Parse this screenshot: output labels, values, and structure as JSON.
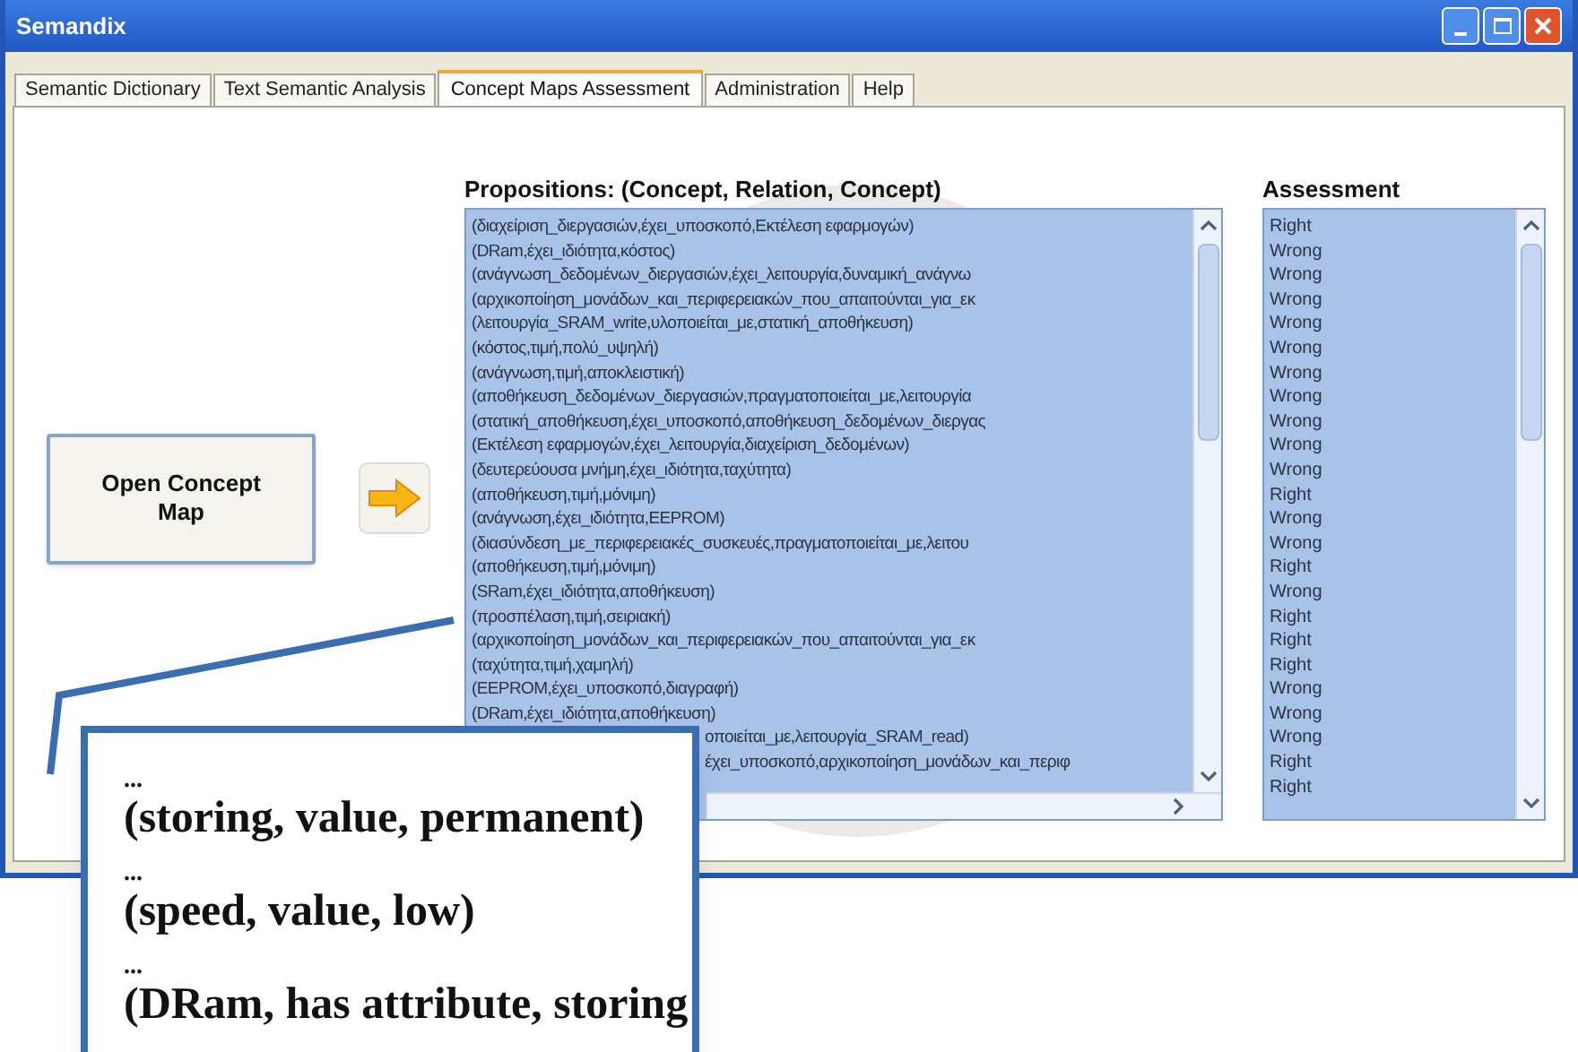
{
  "window": {
    "title": "Semandix"
  },
  "tabs": [
    {
      "label": "Semantic Dictionary",
      "selected": false
    },
    {
      "label": "Text Semantic Analysis",
      "selected": false
    },
    {
      "label": "Concept Maps Assessment",
      "selected": true
    },
    {
      "label": "Administration",
      "selected": false
    },
    {
      "label": "Help",
      "selected": false
    }
  ],
  "open_button": {
    "label": "Open Concept Map"
  },
  "propositions": {
    "header": "Propositions: (Concept, Relation, Concept)",
    "rows": [
      {
        "text": "(διαχείριση_διεργασιών,έχει_υποσκοπό,Εκτέλεση εφαρμογών)",
        "kind": "full"
      },
      {
        "text": "(DRam,έχει_ιδιότητα,κόστος)",
        "kind": "full"
      },
      {
        "text": "(ανάγνωση_δεδομένων_διεργασιών,έχει_λειτουργία,δυναμική_ανάγνω",
        "kind": "full"
      },
      {
        "text": "(αρχικοποίηση_μονάδων_και_περιφερειακών_που_απαιτούνται_για_εκ",
        "kind": "full"
      },
      {
        "text": "(λειτουργία_SRAM_write,υλοποιείται_με,στατική_αποθήκευση)",
        "kind": "full"
      },
      {
        "text": "(κόστος,τιμή,πολύ_υψηλή)",
        "kind": "full"
      },
      {
        "text": "(ανάγνωση,τιμή,αποκλειστική)",
        "kind": "full"
      },
      {
        "text": "(αποθήκευση_δεδομένων_διεργασιών,πραγματοποιείται_με,λειτουργία",
        "kind": "full"
      },
      {
        "text": "(στατική_αποθήκευση,έχει_υποσκοπό,αποθήκευση_δεδομένων_διεργας",
        "kind": "full"
      },
      {
        "text": "(Εκτέλεση εφαρμογών,έχει_λειτουργία,διαχείριση_δεδομένων)",
        "kind": "full"
      },
      {
        "text": "(δευτερεύουσα μνήμη,έχει_ιδιότητα,ταχύτητα)",
        "kind": "full"
      },
      {
        "text": "(αποθήκευση,τιμή,μόνιμη)",
        "kind": "full"
      },
      {
        "text": "(ανάγνωση,έχει_ιδιότητα,EEPROM)",
        "kind": "full"
      },
      {
        "text": "(διασύνδεση_με_περιφερειακές_συσκευές,πραγματοποιείται_με,λειτου",
        "kind": "full"
      },
      {
        "text": "(αποθήκευση,τιμή,μόνιμη)",
        "kind": "full"
      },
      {
        "text": "(SRam,έχει_ιδιότητα,αποθήκευση)",
        "kind": "full"
      },
      {
        "text": "(προσπέλαση,τιμή,σειριακή)",
        "kind": "full"
      },
      {
        "text": "(αρχικοποίηση_μονάδων_και_περιφερειακών_που_απαιτούνται_για_εκ",
        "kind": "full"
      },
      {
        "text": "(ταχύτητα,τιμή,χαμηλή)",
        "kind": "full"
      },
      {
        "text": "(EEPROM,έχει_υποσκοπό,διαγραφή)",
        "kind": "full"
      },
      {
        "text": "(DRam,έχει_ιδιότητα,αποθήκευση)",
        "kind": "full"
      },
      {
        "text": "οποιείται_με,λειτουργία_SRAM_read)",
        "kind": "covered"
      },
      {
        "text": "έχει_υποσκοπό,αρχικοποίηση_μονάδων_και_περιφ",
        "kind": "covered"
      }
    ]
  },
  "assessment": {
    "header": "Assessment",
    "rows": [
      "Right",
      "Wrong",
      "Wrong",
      "Wrong",
      "Wrong",
      "Wrong",
      "Wrong",
      "Wrong",
      "Wrong",
      "Wrong",
      "Wrong",
      "Right",
      "Wrong",
      "Wrong",
      "Right",
      "Wrong",
      "Right",
      "Right",
      "Right",
      "Wrong",
      "Wrong",
      "Wrong",
      "Right",
      "Right"
    ]
  },
  "callout": {
    "lines": [
      "...",
      "(storing, value, permanent)",
      "...",
      "(speed, value, low)",
      "...",
      "(DRam, has attribute, storing"
    ]
  }
}
